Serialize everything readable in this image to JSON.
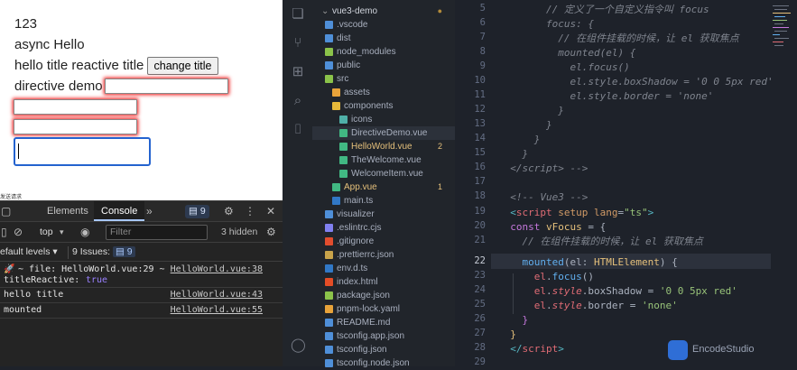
{
  "browser_page": {
    "lines": [
      "123",
      "async Hello",
      "hello title reactive title",
      "directive demo"
    ],
    "change_button": "change title",
    "tiny_text": "发送请求"
  },
  "devtools": {
    "tabs": [
      "Elements",
      "Console"
    ],
    "more": "»",
    "issues_badge": "9",
    "context": "top",
    "filter_placeholder": "Filter",
    "hidden": "3 hidden",
    "levels": "efault levels ▾",
    "issues_label": "9 Issues:",
    "issues_count": "9",
    "logs": [
      {
        "text": "~ file: HelloWorld.vue:29 ~",
        "text2": "titleReactive:",
        "value": "true",
        "src": "HelloWorld.vue:38"
      },
      {
        "text": "hello title",
        "src": "HelloWorld.vue:43"
      },
      {
        "text": "mounted",
        "src": "HelloWorld.vue:55"
      }
    ]
  },
  "explorer": {
    "root": "vue3-demo",
    "items": [
      {
        "label": ".vscode",
        "color": "#4f8fd8",
        "badge": ""
      },
      {
        "label": "dist",
        "color": "#4f8fd8",
        "badge": ""
      },
      {
        "label": "node_modules",
        "color": "#8bc34a",
        "badge": ""
      },
      {
        "label": "public",
        "color": "#4f8fd8",
        "badge": ""
      },
      {
        "label": "src",
        "color": "#8bc34a",
        "badge": ""
      },
      {
        "label": "assets",
        "color": "#e8a33a",
        "badge": ""
      },
      {
        "label": "components",
        "color": "#e8b93a",
        "badge": ""
      },
      {
        "label": "icons",
        "color": "#4fb0a8",
        "badge": ""
      },
      {
        "label": "DirectiveDemo.vue",
        "color": "#41b883",
        "badge": ""
      },
      {
        "label": "HelloWorld.vue",
        "color": "#41b883",
        "badge": "2"
      },
      {
        "label": "TheWelcome.vue",
        "color": "#41b883",
        "badge": ""
      },
      {
        "label": "WelcomeItem.vue",
        "color": "#41b883",
        "badge": ""
      },
      {
        "label": "App.vue",
        "color": "#41b883",
        "badge": "1"
      },
      {
        "label": "main.ts",
        "color": "#3178c6",
        "badge": ""
      },
      {
        "label": "visualizer",
        "color": "#4f8fd8",
        "badge": ""
      },
      {
        "label": ".eslintrc.cjs",
        "color": "#8080f0",
        "badge": ""
      },
      {
        "label": ".gitignore",
        "color": "#e24d2e",
        "badge": ""
      },
      {
        "label": ".prettierrc.json",
        "color": "#c8a34a",
        "badge": ""
      },
      {
        "label": "env.d.ts",
        "color": "#3178c6",
        "badge": ""
      },
      {
        "label": "index.html",
        "color": "#e44d26",
        "badge": ""
      },
      {
        "label": "package.json",
        "color": "#8bc34a",
        "badge": ""
      },
      {
        "label": "pnpm-lock.yaml",
        "color": "#e8a33a",
        "badge": ""
      },
      {
        "label": "README.md",
        "color": "#4f8fd8",
        "badge": ""
      },
      {
        "label": "tsconfig.app.json",
        "color": "#4f8fd8",
        "badge": ""
      },
      {
        "label": "tsconfig.json",
        "color": "#4f8fd8",
        "badge": ""
      },
      {
        "label": "tsconfig.node.json",
        "color": "#4f8fd8",
        "badge": ""
      }
    ]
  },
  "editor": {
    "line_numbers": [
      "5",
      "6",
      "7",
      "8",
      "9",
      "10",
      "11",
      "12",
      "13",
      "14",
      "15",
      "16",
      "17",
      "18",
      "19",
      "20",
      "21",
      "22",
      "23",
      "24",
      "25",
      "26",
      "27",
      "28",
      "29"
    ],
    "current_line": "22",
    "watermark": "EncodeStudio"
  }
}
